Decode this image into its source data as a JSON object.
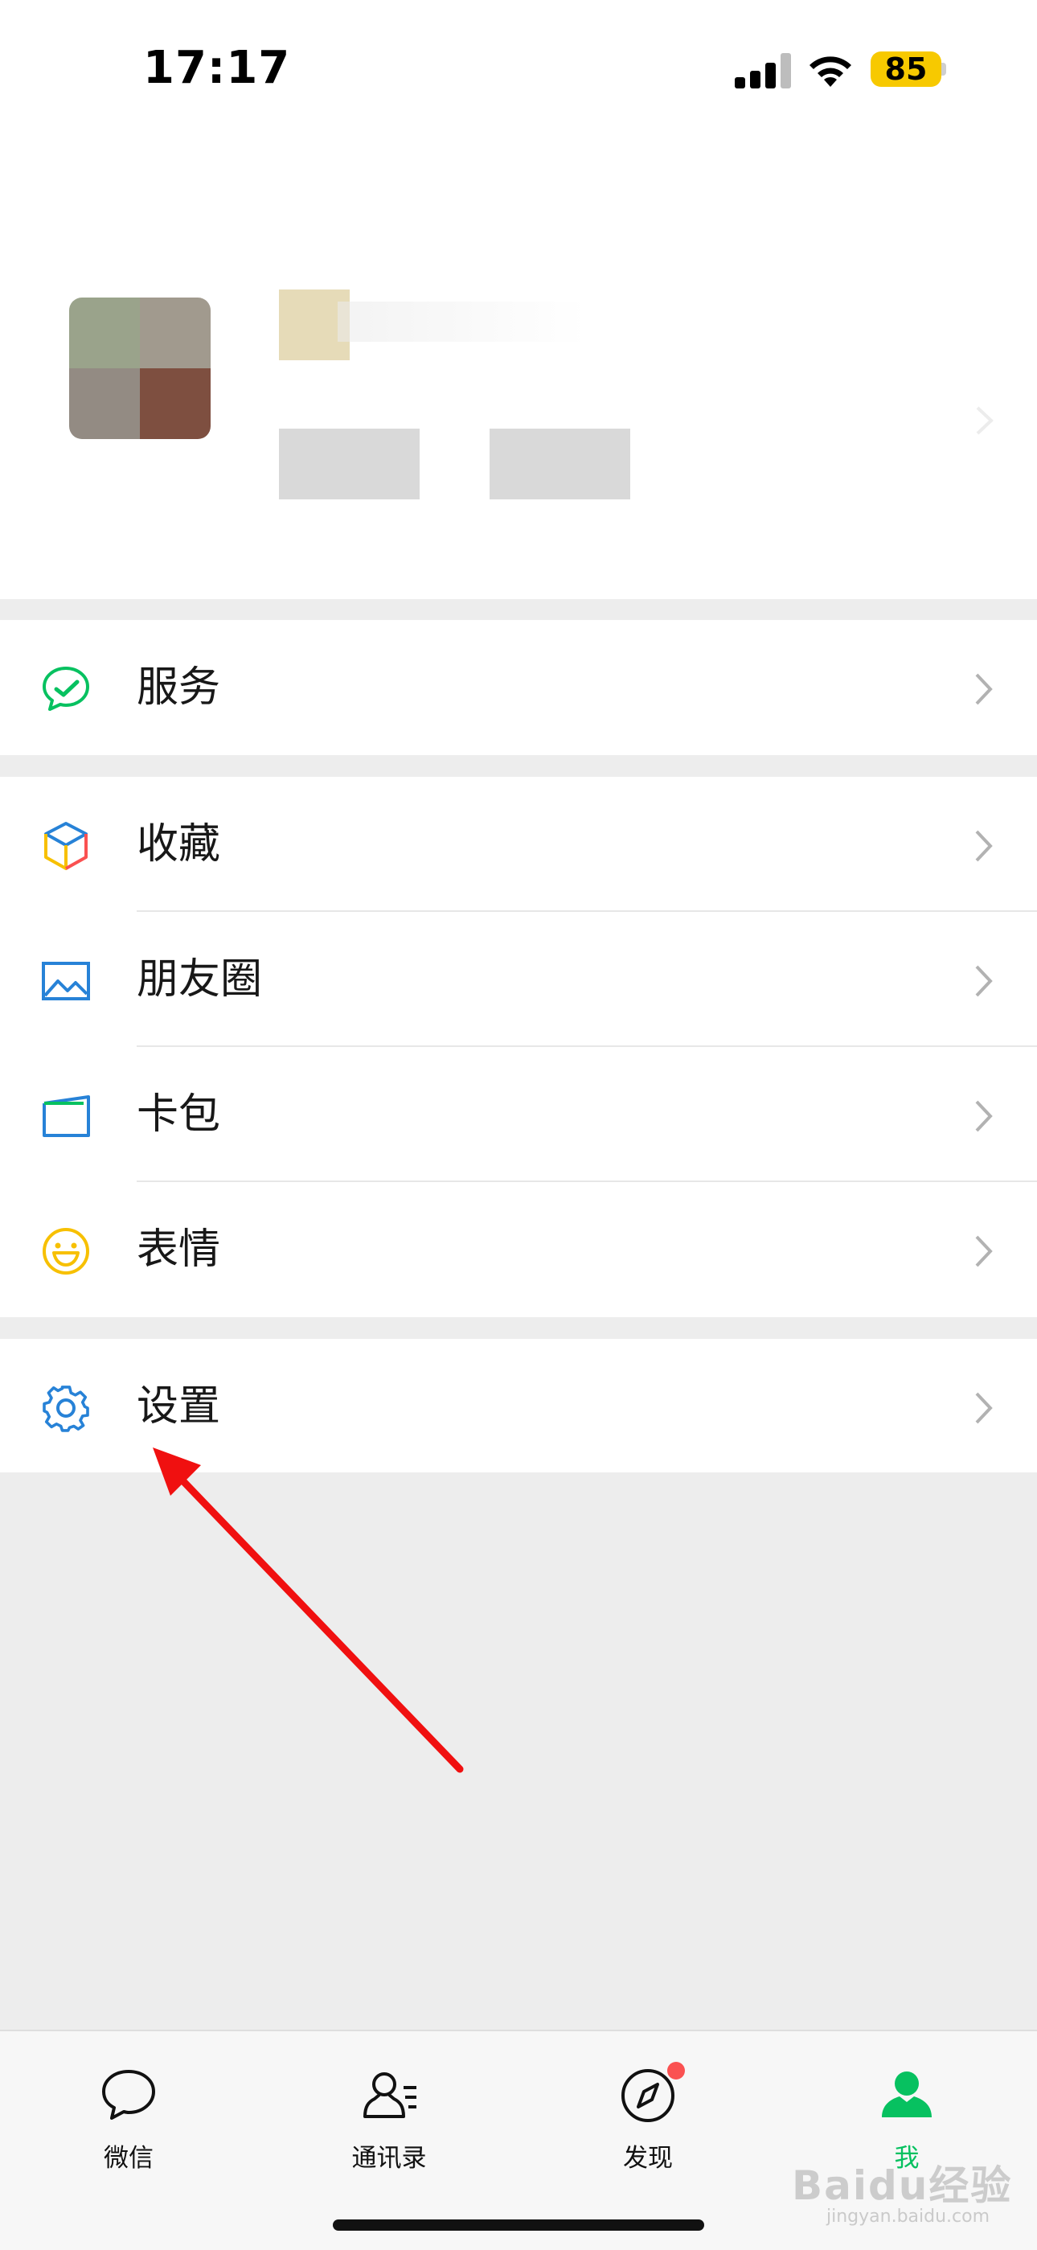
{
  "status_bar": {
    "time": "17:17",
    "battery": "85"
  },
  "menu": {
    "service": "服务",
    "favorites": "收藏",
    "moments": "朋友圈",
    "cards": "卡包",
    "stickers": "表情",
    "settings": "设置"
  },
  "tabs": [
    {
      "label": "微信",
      "icon": "chat-bubble-icon"
    },
    {
      "label": "通讯录",
      "icon": "contacts-icon"
    },
    {
      "label": "发现",
      "icon": "compass-icon",
      "badge": true
    },
    {
      "label": "我",
      "icon": "person-icon",
      "active": true
    }
  ],
  "colors": {
    "accent_green": "#07c160",
    "badge_red": "#fa5151",
    "annotation_arrow": "#f01010",
    "battery_yellow": "#f7c900"
  },
  "watermark": {
    "brand": "Baidu经验",
    "url": "jingyan.baidu.com"
  }
}
